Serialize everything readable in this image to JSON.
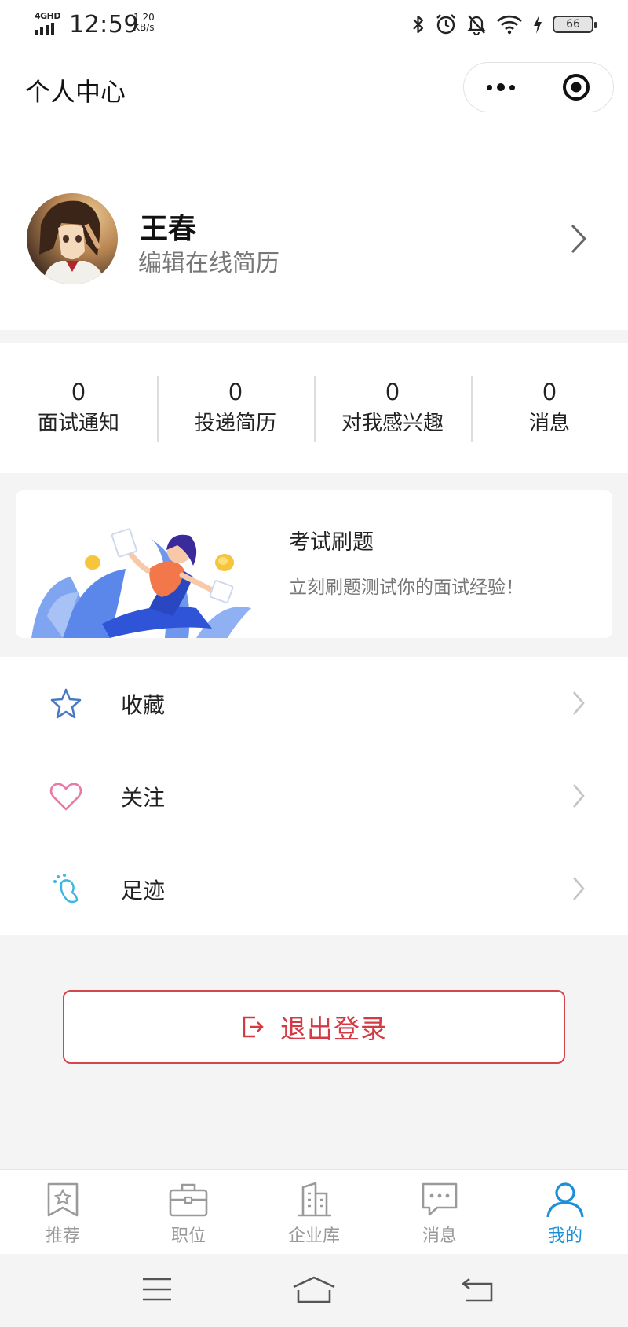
{
  "status_bar": {
    "network": "4GHD",
    "time": "12:59",
    "speed_value": "1.20",
    "speed_unit": "KB/s",
    "battery": "66",
    "icons": [
      "bluetooth-icon",
      "alarm-icon",
      "mute-icon",
      "wifi-icon",
      "charging-icon",
      "battery-icon"
    ]
  },
  "header": {
    "title": "个人中心",
    "capsule_icons": [
      "more-dots-icon",
      "target-icon"
    ]
  },
  "profile": {
    "name": "王春",
    "subtitle": "编辑在线简历"
  },
  "stats": [
    {
      "value": "0",
      "label": "面试通知"
    },
    {
      "value": "0",
      "label": "投递简历"
    },
    {
      "value": "0",
      "label": "对我感兴趣"
    },
    {
      "value": "0",
      "label": "消息"
    }
  ],
  "banner": {
    "title": "考试刷题",
    "desc": "立刻刷题测试你的面试经验！"
  },
  "menu": [
    {
      "label": "收藏",
      "icon": "star-icon",
      "color": "#4a78c4"
    },
    {
      "label": "关注",
      "icon": "heart-icon",
      "color": "#e77aa6"
    },
    {
      "label": "足迹",
      "icon": "footprint-icon",
      "color": "#3db7df"
    }
  ],
  "logout": {
    "label": "退出登录",
    "color": "#d43a44"
  },
  "tabbar": {
    "active": "我的",
    "active_color": "#1e8fd6",
    "items": [
      {
        "label": "推荐",
        "icon": "recommend-icon"
      },
      {
        "label": "职位",
        "icon": "briefcase-icon"
      },
      {
        "label": "企业库",
        "icon": "building-icon"
      },
      {
        "label": "消息",
        "icon": "message-icon"
      },
      {
        "label": "我的",
        "icon": "user-icon"
      }
    ]
  },
  "system_nav": [
    "menu-icon",
    "home-icon",
    "back-icon"
  ]
}
